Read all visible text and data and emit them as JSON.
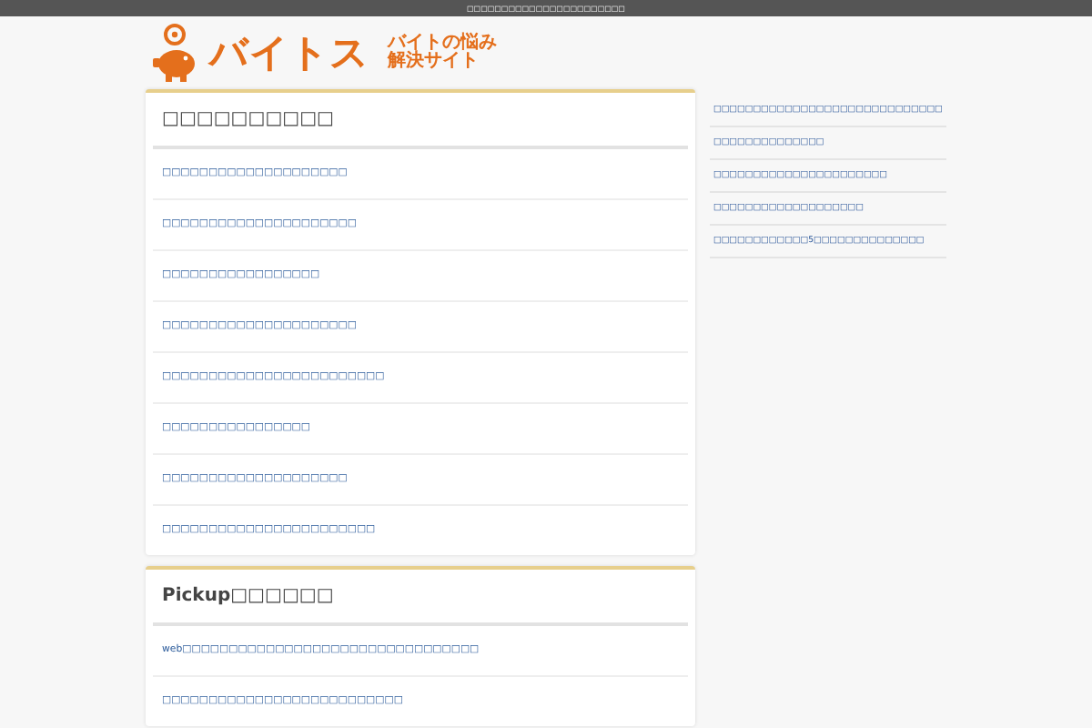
{
  "top_bar": {
    "text": "□□□□□□□□□□□□□□□□□□□□□□□"
  },
  "logo": {
    "name": "バイトス",
    "tagline": [
      "バイトの悩み",
      "解決サイト"
    ]
  },
  "sections": [
    {
      "title": "□□□□□□□□□□",
      "items": [
        "□□□□□□□□□□□□□□□□□□□□",
        "□□□□□□□□□□□□□□□□□□□□□",
        "□□□□□□□□□□□□□□□□□",
        "□□□□□□□□□□□□□□□□□□□□□",
        "□□□□□□□□□□□□□□□□□□□□□□□□",
        "□□□□□□□□□□□□□□□□",
        "□□□□□□□□□□□□□□□□□□□□",
        "□□□□□□□□□□□□□□□□□□□□□□□"
      ]
    },
    {
      "title": "Pickup□□□□□□",
      "items": [
        "web□□□□□□□□□□□□□□□□□□□□□□□□□□□□□□□□",
        "□□□□□□□□□□□□□□□□□□□□□□□□□□"
      ]
    }
  ],
  "sidebar": {
    "links": [
      "□□□□□□□□□□□□□□□□□□□□□□□□□□□□□",
      "□□□□□□□□□□□□□□",
      "□□□□□□□□□□□□□□□□□□□□□□",
      "□□□□□□□□□□□□□□□□□□□",
      "□□□□□□□□□□□□5□□□□□□□□□□□□□□"
    ]
  }
}
